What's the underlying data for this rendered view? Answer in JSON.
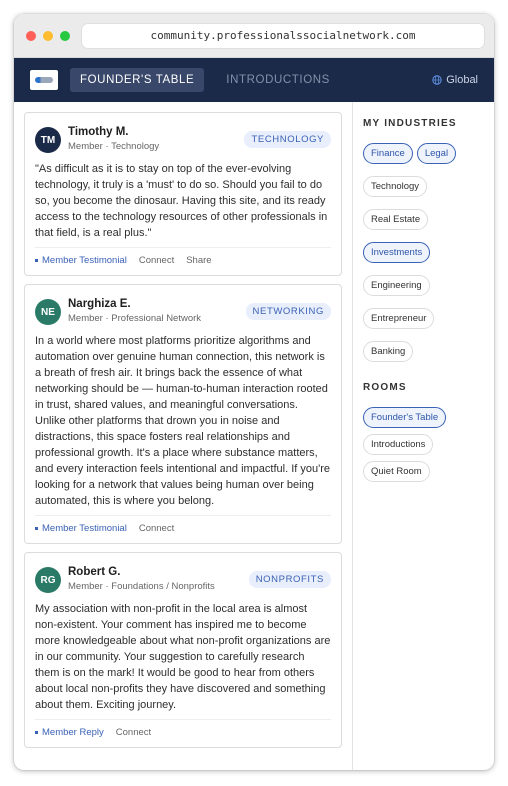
{
  "browser": {
    "url": "community.professionalssocialnetwork.com"
  },
  "nav": {
    "tabs": [
      {
        "label": "FOUNDER'S TABLE"
      },
      {
        "label": "INTRODUCTIONS"
      }
    ],
    "global_label": "Global"
  },
  "posts": [
    {
      "initials": "TM",
      "name": "Timothy M.",
      "role": "Member · Technology",
      "tag": "TECHNOLOGY",
      "body": "\"As difficult as it is to stay on top of the ever-evolving technology, it truly is a 'must' to do so. Should you fail to do so, you become the dinosaur. Having this site, and its ready access to the technology resources of other professionals in that field, is a real plus.\"",
      "actions": {
        "primary": "Member Testimonial",
        "connect": "Connect",
        "share": "Share"
      }
    },
    {
      "initials": "NE",
      "name": "Narghiza E.",
      "role": "Member · Professional Network",
      "tag": "NETWORKING",
      "body": "In a world where most platforms prioritize algorithms and automation over genuine human connection, this network is a breath of fresh air. It brings back the essence of what networking should be — human-to-human interaction rooted in trust, shared values, and meaningful conversations. Unlike other platforms that drown you in noise and distractions, this space fosters real relationships and professional growth. It's a place where substance matters, and every interaction feels intentional and impactful. If you're looking for a network that values being human over being automated, this is where you belong.",
      "actions": {
        "primary": "Member Testimonial",
        "connect": "Connect"
      }
    },
    {
      "initials": "RG",
      "name": "Robert G.",
      "role": "Member · Foundations / Nonprofits",
      "tag": "NONPROFITS",
      "body": "My association with non-profit in the local area is almost non-existent. Your comment has inspired me to become more knowledgeable about what non-profit organizations are in our community. Your suggestion to carefully research them is on the mark! It would be good to hear from others about local non-profits they have discovered and something about them. Exciting journey.",
      "actions": {
        "primary": "Member Reply",
        "connect": "Connect"
      }
    }
  ],
  "sidebar": {
    "industries_title": "MY INDUSTRIES",
    "industries": [
      {
        "label": "Finance",
        "selected": true
      },
      {
        "label": "Legal",
        "selected": true
      },
      {
        "label": "Technology",
        "selected": false
      },
      {
        "label": "Real Estate",
        "selected": false
      },
      {
        "label": "Investments",
        "selected": true
      },
      {
        "label": "Engineering",
        "selected": false
      },
      {
        "label": "Entrepreneur",
        "selected": false
      },
      {
        "label": "Banking",
        "selected": false
      }
    ],
    "rooms_title": "ROOMS",
    "rooms": [
      {
        "label": "Founder's Table",
        "selected": true
      },
      {
        "label": "Introductions",
        "selected": false
      },
      {
        "label": "Quiet Room",
        "selected": false
      }
    ]
  },
  "colors": {
    "nav_bg": "#1c2a4a",
    "accent": "#3a62b5",
    "avatar_teal": "#2b7a68"
  },
  "icons": {
    "global": "globe-icon"
  }
}
